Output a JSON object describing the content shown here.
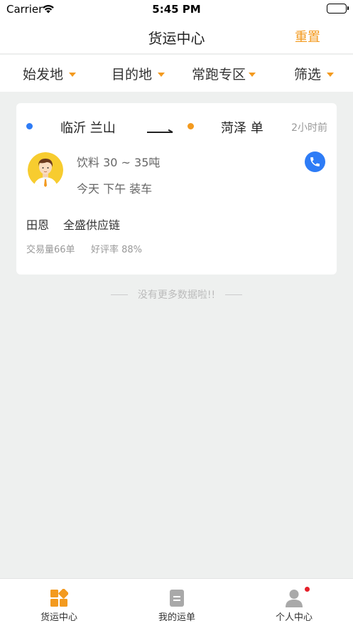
{
  "status_bar": {
    "carrier": "Carrier",
    "time": "5:45 PM"
  },
  "header": {
    "title": "货运中心",
    "reset_label": "重置"
  },
  "filters": [
    {
      "label": "始发地"
    },
    {
      "label": "目的地"
    },
    {
      "label": "常跑专区"
    },
    {
      "label": "筛选"
    }
  ],
  "listing": {
    "origin": "临沂 兰山",
    "destination": "菏泽 单",
    "time_ago": "2小时前",
    "cargo": "饮料 30 ~ 35吨",
    "loading_time": "今天 下午 装车",
    "shipper_name": "田恩",
    "company": "全盛供应链",
    "deals": "交易量66单",
    "rating": "好评率 88%"
  },
  "list_footer": "没有更多数据啦!!",
  "tab_bar": {
    "tabs": [
      {
        "label": "货运中心",
        "icon": "grid-icon",
        "active": true
      },
      {
        "label": "我的运单",
        "icon": "document-icon",
        "active": false
      },
      {
        "label": "个人中心",
        "icon": "person-icon",
        "active": false,
        "badge": true
      }
    ]
  },
  "colors": {
    "accent": "#f39a1f",
    "origin_dot": "#2e7cf6",
    "phone": "#2e7cf6",
    "badge": "#e5202a",
    "background": "#eef0ef"
  }
}
